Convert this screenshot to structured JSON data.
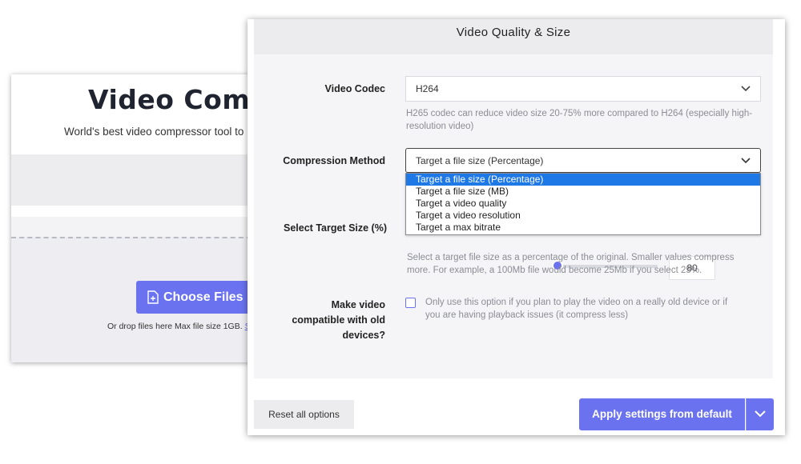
{
  "background_page": {
    "title": "Video Comp",
    "subtitle": "World's best video compressor tool to",
    "choose_files_label": "Choose Files",
    "drop_text": "Or drop files here Max file size 1GB.",
    "drop_link": "S"
  },
  "panel": {
    "header_title": "Video Quality & Size",
    "video_codec": {
      "label": "Video Codec",
      "value": "H264",
      "help_line1": "H265 codec can reduce video size 20-75% more compared to H264 (especially high-",
      "help_line2": "resolution video)"
    },
    "compression_method": {
      "label": "Compression Method",
      "value": "Target a file size (Percentage)",
      "options": [
        "Target a file size (Percentage)",
        "Target a file size (MB)",
        "Target a video quality",
        "Target a video resolution",
        "Target a max bitrate"
      ],
      "selected_index": 0
    },
    "target_size": {
      "label": "Select Target Size (%)",
      "value": "80",
      "help_line1": "Select a target file size as a percentage of the original. Smaller values compress",
      "help_line2": "more. For example, a 100Mb file would become 25Mb if you select 25%."
    },
    "old_devices": {
      "label_line1": "Make video",
      "label_line2": "compatible with old",
      "label_line3": "devices?",
      "checked": false,
      "help_line1": "Only use this option if you plan to play the video on a really old device or if",
      "help_line2": "you are having playback issues (it compress less)"
    },
    "reset_label": "Reset all options",
    "apply_label": "Apply settings from default"
  },
  "colors": {
    "accent": "#6a72f0",
    "selected_option": "#1e78e6"
  },
  "icons": [
    "file-add-icon",
    "chevron-down-icon"
  ]
}
